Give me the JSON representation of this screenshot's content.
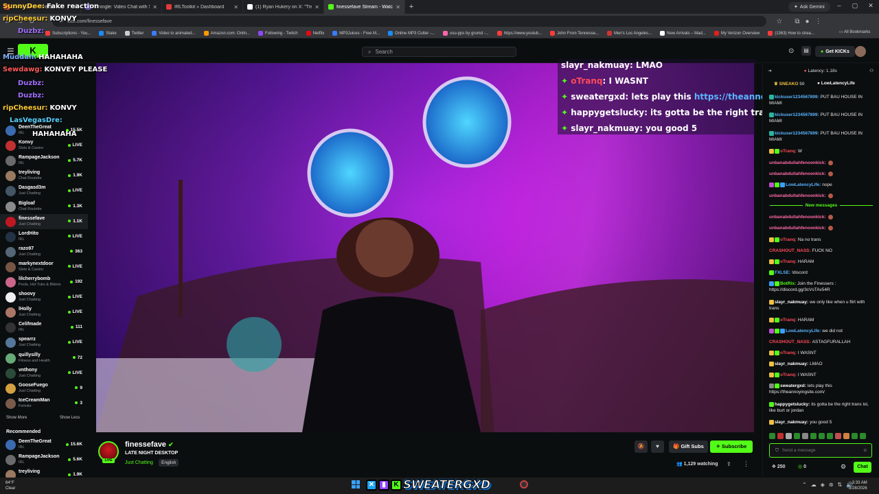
{
  "browser": {
    "tabs": [
      {
        "label": "SunnyDee · Stream",
        "color": "#ff5a3c"
      },
      {
        "label": "Umingle: Video Chat with St",
        "color": "#8c6cff"
      },
      {
        "label": "IRLToolkit » Dashboard",
        "color": "#e23a3a"
      },
      {
        "label": "(1) Ryan Hukery on X: \"TreyLivin",
        "color": "#ffffff"
      },
      {
        "label": "finessefave Stream - Watch",
        "color": "#53fc18"
      }
    ],
    "new_tab": "+",
    "gemini": "Ask Gemini",
    "url": "kick.com/finessefave",
    "bookmarks": [
      {
        "label": "Subscriptions - You...",
        "color": "#ff3b3b"
      },
      {
        "label": "Stake",
        "color": "#1b8cff"
      },
      {
        "label": "Twitter",
        "color": "#cccccc"
      },
      {
        "label": "Video to animated...",
        "color": "#3b7bff"
      },
      {
        "label": "Amazon.com: Onlin...",
        "color": "#ff9900"
      },
      {
        "label": "Following - Twitch",
        "color": "#9146ff"
      },
      {
        "label": "Netflix",
        "color": "#e50914"
      },
      {
        "label": "MP3Juices - Free M...",
        "color": "#3b7bff"
      },
      {
        "label": "Online MP3 Cutter -...",
        "color": "#1b8cff"
      },
      {
        "label": "osu-pps by grumd -...",
        "color": "#ff66aa"
      },
      {
        "label": "https://www.youtub...",
        "color": "#ff3b3b"
      },
      {
        "label": "John From Tennesse...",
        "color": "#ff3b3b"
      },
      {
        "label": "Men's Los Angeles...",
        "color": "#d03333"
      },
      {
        "label": "New Arrivals – Mad...",
        "color": "#ffffff"
      },
      {
        "label": "My Verizon Overview",
        "color": "#e01f1f"
      },
      {
        "label": "(1363) How to strea...",
        "color": "#ff3b3b"
      }
    ],
    "all_bookmarks": "All Bookmarks"
  },
  "header": {
    "search_placeholder": "Search",
    "get_kicks": "Get KICKs"
  },
  "sidebar": {
    "following": [
      {
        "name": "DeenTheGreat",
        "category": "IRL",
        "viewers": "15.5K",
        "color": "#3b6bb0"
      },
      {
        "name": "Konvy",
        "category": "Slots & Casino",
        "viewers": "LIVE",
        "color": "#c03030"
      },
      {
        "name": "RampageJackson",
        "category": "IRL",
        "viewers": "5.7K",
        "color": "#6a6a6a"
      },
      {
        "name": "treyliving",
        "category": "Chat Roulette",
        "viewers": "1.9K",
        "color": "#9a7a60"
      },
      {
        "name": "Dasgasd3m",
        "category": "Just Chatting",
        "viewers": "LIVE",
        "color": "#445566"
      },
      {
        "name": "Bigloaf",
        "category": "Chat Roulette",
        "viewers": "1.3K",
        "color": "#8a8a8a"
      },
      {
        "name": "finessefave",
        "category": "Just Chatting",
        "viewers": "1.1K",
        "color": "#c01822"
      },
      {
        "name": "LordHito",
        "category": "IRL",
        "viewers": "LIVE",
        "color": "#223344"
      },
      {
        "name": "razo97",
        "category": "Just Chatting",
        "viewers": "363",
        "color": "#556677"
      },
      {
        "name": "markynextdoor",
        "category": "Slots & Casino",
        "viewers": "LIVE",
        "color": "#775544"
      },
      {
        "name": "lilcherrybomb",
        "category": "Pools, Hot Tubs & Bikinis",
        "viewers": "192",
        "color": "#cc6688"
      },
      {
        "name": "shoovy",
        "category": "Just Chatting",
        "viewers": "LIVE",
        "color": "#eeeeee"
      },
      {
        "name": "lHolly",
        "category": "Just Chatting",
        "viewers": "LIVE",
        "color": "#aa7766"
      },
      {
        "name": "Celifmade",
        "category": "IRL",
        "viewers": "111",
        "color": "#333333"
      },
      {
        "name": "spearrz",
        "category": "Just Chatting",
        "viewers": "LIVE",
        "color": "#557799"
      },
      {
        "name": "quillysilly",
        "category": "Fitness and Health",
        "viewers": "72",
        "color": "#66aa77"
      },
      {
        "name": "vnthony",
        "category": "Just Chatting",
        "viewers": "LIVE",
        "color": "#2a4a3a"
      },
      {
        "name": "GooseFuego",
        "category": "Just Chatting",
        "viewers": "9",
        "color": "#d4a040"
      },
      {
        "name": "IceCreamMan",
        "category": "Fortnite",
        "viewers": "3",
        "color": "#7a5a4a"
      }
    ],
    "show_more": "Show More",
    "show_less": "Show Less",
    "recommended_title": "Recommended",
    "recommended": [
      {
        "name": "DeenTheGreat",
        "category": "IRL",
        "viewers": "15.6K",
        "color": "#3b6bb0"
      },
      {
        "name": "RampageJackson",
        "category": "IRL",
        "viewers": "5.6K",
        "color": "#6a6a6a"
      },
      {
        "name": "treyliving",
        "category": "",
        "viewers": "1.9K",
        "color": "#9a7a60"
      }
    ]
  },
  "overlay_left": [
    {
      "user": "SunnyDee:",
      "text": "Fake reaction",
      "color": "#ffcc33"
    },
    {
      "user": "ripCheesur:",
      "text": "KONVY",
      "color": "#ffcc33"
    },
    {
      "user": "Duzbz:",
      "text": "",
      "color": "#a070ff"
    },
    {
      "user": "Muddah:",
      "text": "HAHAHAHA",
      "color": "#7ab0ff"
    },
    {
      "user": "Sewdawg:",
      "text": "KONVEY PLEASE",
      "color": "#ff5a5a"
    },
    {
      "user": "Duzbz:",
      "text": "",
      "color": "#a070ff"
    },
    {
      "user": "Duzbz:",
      "text": "",
      "color": "#a070ff"
    },
    {
      "user": "ripCheesur:",
      "text": "KONVY",
      "color": "#ffcc33"
    },
    {
      "user": "LasVegasDre:",
      "text": "",
      "color": "#5ad0ff"
    },
    {
      "user": "",
      "text": "HAHAHAHA",
      "color": "#ffffff"
    }
  ],
  "overlay_chat": [
    {
      "user": "slayr_nakmuay",
      "text": ": LMAO",
      "color": "#ffffff"
    },
    {
      "user": "oTranq",
      "text": ": I WASNT",
      "color": "#ff4a5a"
    },
    {
      "user": "sweatergxd",
      "text": ": lets play this ",
      "link": "https://theannoyingsi",
      "color": "#ffffff"
    },
    {
      "user": "happygetslucky",
      "text": ": its gotta be the right trans lol, l",
      "color": "#ffffff"
    },
    {
      "user": "slayr_nakmuay",
      "text": ": you good 5",
      "color": "#ffffff"
    }
  ],
  "stream": {
    "channel": "finessefave",
    "title": "LATE NIGHT DESKTOP",
    "category": "Just Chatting",
    "language": "English",
    "live": "LIVE",
    "gift_subs": "Gift Subs",
    "subscribe": "Subscribe",
    "watching": "1,129 watching"
  },
  "chat": {
    "latency": "Latency: 1.18s",
    "pinned_left": "SNEAKO",
    "pinned_left_count": "50",
    "pinned_right": "LowLatencyLife",
    "new_messages": "New messages",
    "messages": [
      {
        "user": "kickuser1234567899:",
        "text": "PUT BAU HOUSE IN MIAMI",
        "color": "#5ab4ff",
        "badges": [
          "#2ab5a0"
        ]
      },
      {
        "user": "kickuser1234567899:",
        "text": "PUT BAU HOUSE IN MIAMI",
        "color": "#5ab4ff",
        "badges": [
          "#2ab5a0"
        ]
      },
      {
        "user": "kickuser1234567899:",
        "text": "PUT BAU HOUSE IN MIAMI",
        "color": "#5ab4ff",
        "badges": [
          "#2ab5a0"
        ]
      },
      {
        "user": "oTranq:",
        "text": "W",
        "color": "#ff4a5a",
        "badges": [
          "#f0c040",
          "#53fc18"
        ]
      },
      {
        "user": "unbanabdullahfenoonkick:",
        "text": "",
        "color": "#ff6aa8",
        "badges": []
      },
      {
        "user": "unbanabdullahfenoonkick:",
        "text": "",
        "color": "#ff6aa8",
        "badges": []
      },
      {
        "user": "LowLatencyLife:",
        "text": "nope",
        "color": "#5ab4ff",
        "badges": [
          "#c050d0",
          "#53fc18",
          "#3aa0ff"
        ]
      },
      {
        "user": "unbanabdullahfenoonkick:",
        "text": "",
        "color": "#ff6aa8",
        "badges": []
      },
      {
        "user": "unbanabdullahfenoonkick:",
        "text": "",
        "color": "#ff6aa8",
        "badges": []
      },
      {
        "user": "unbanabdullahfenoonkick:",
        "text": "",
        "color": "#ff6aa8",
        "badges": []
      },
      {
        "user": "oTranq:",
        "text": "Na no trans",
        "color": "#ff4a5a",
        "badges": [
          "#f0c040",
          "#53fc18"
        ]
      },
      {
        "user": "CRASHOUT_NASS:",
        "text": "FUCK NO",
        "color": "#ff4a5a",
        "badges": []
      },
      {
        "user": "oTranq:",
        "text": "HARAM",
        "color": "#ff4a5a",
        "badges": [
          "#f0c040",
          "#53fc18"
        ]
      },
      {
        "user": "FXLSE:",
        "text": "!discord",
        "color": "#5ab4ff",
        "badges": [
          "#53fc18"
        ]
      },
      {
        "user": "BotRix:",
        "text": "Join the Finessers : https://discord.gg/3cVsTAv54R",
        "color": "#53fc18",
        "badges": [
          "#3aa0ff",
          "#53fc18"
        ]
      },
      {
        "user": "slayr_nakmuay:",
        "text": "we only like when u flirt with trans",
        "color": "#ffffff",
        "badges": [
          "#f0c040"
        ]
      },
      {
        "user": "oTranq:",
        "text": "HARAM",
        "color": "#ff4a5a",
        "badges": [
          "#f0c040",
          "#53fc18"
        ]
      },
      {
        "user": "LowLatencyLife:",
        "text": "we did not",
        "color": "#5ab4ff",
        "badges": [
          "#c050d0",
          "#53fc18",
          "#3aa0ff"
        ]
      },
      {
        "user": "CRASHOUT_NASS:",
        "text": "ASTAGFURALLAH",
        "color": "#ff4a5a",
        "badges": []
      },
      {
        "user": "oTranq:",
        "text": "I WASNT",
        "color": "#ff4a5a",
        "badges": [
          "#f0c040",
          "#53fc18"
        ]
      },
      {
        "user": "slayr_nakmuay:",
        "text": "LMAO",
        "color": "#ffffff",
        "badges": [
          "#f0c040"
        ]
      },
      {
        "user": "oTranq:",
        "text": "I WASNT",
        "color": "#ff4a5a",
        "badges": [
          "#f0c040",
          "#53fc18"
        ]
      },
      {
        "user": "sweatergxd:",
        "text": "lets play this https://theannoyingsite.com/",
        "color": "#ffffff",
        "badges": [
          "#888888",
          "#53fc18"
        ]
      },
      {
        "user": "happygetslucky:",
        "text": "its gotta be the right trans lol, like burt or jordan",
        "color": "#ffffff",
        "badges": [
          "#53fc18"
        ]
      },
      {
        "user": "slayr_nakmuay:",
        "text": "you good 5",
        "color": "#ffffff",
        "badges": [
          "#f0c040"
        ]
      }
    ],
    "input_placeholder": "Send a message",
    "points": "250",
    "kicks": "0",
    "chat_button": "Chat"
  },
  "taskbar": {
    "temp": "64°F",
    "weather": "Clear",
    "brand": "SWEATERGXD",
    "time": "3:33 AM",
    "date": "8/28/2026"
  }
}
